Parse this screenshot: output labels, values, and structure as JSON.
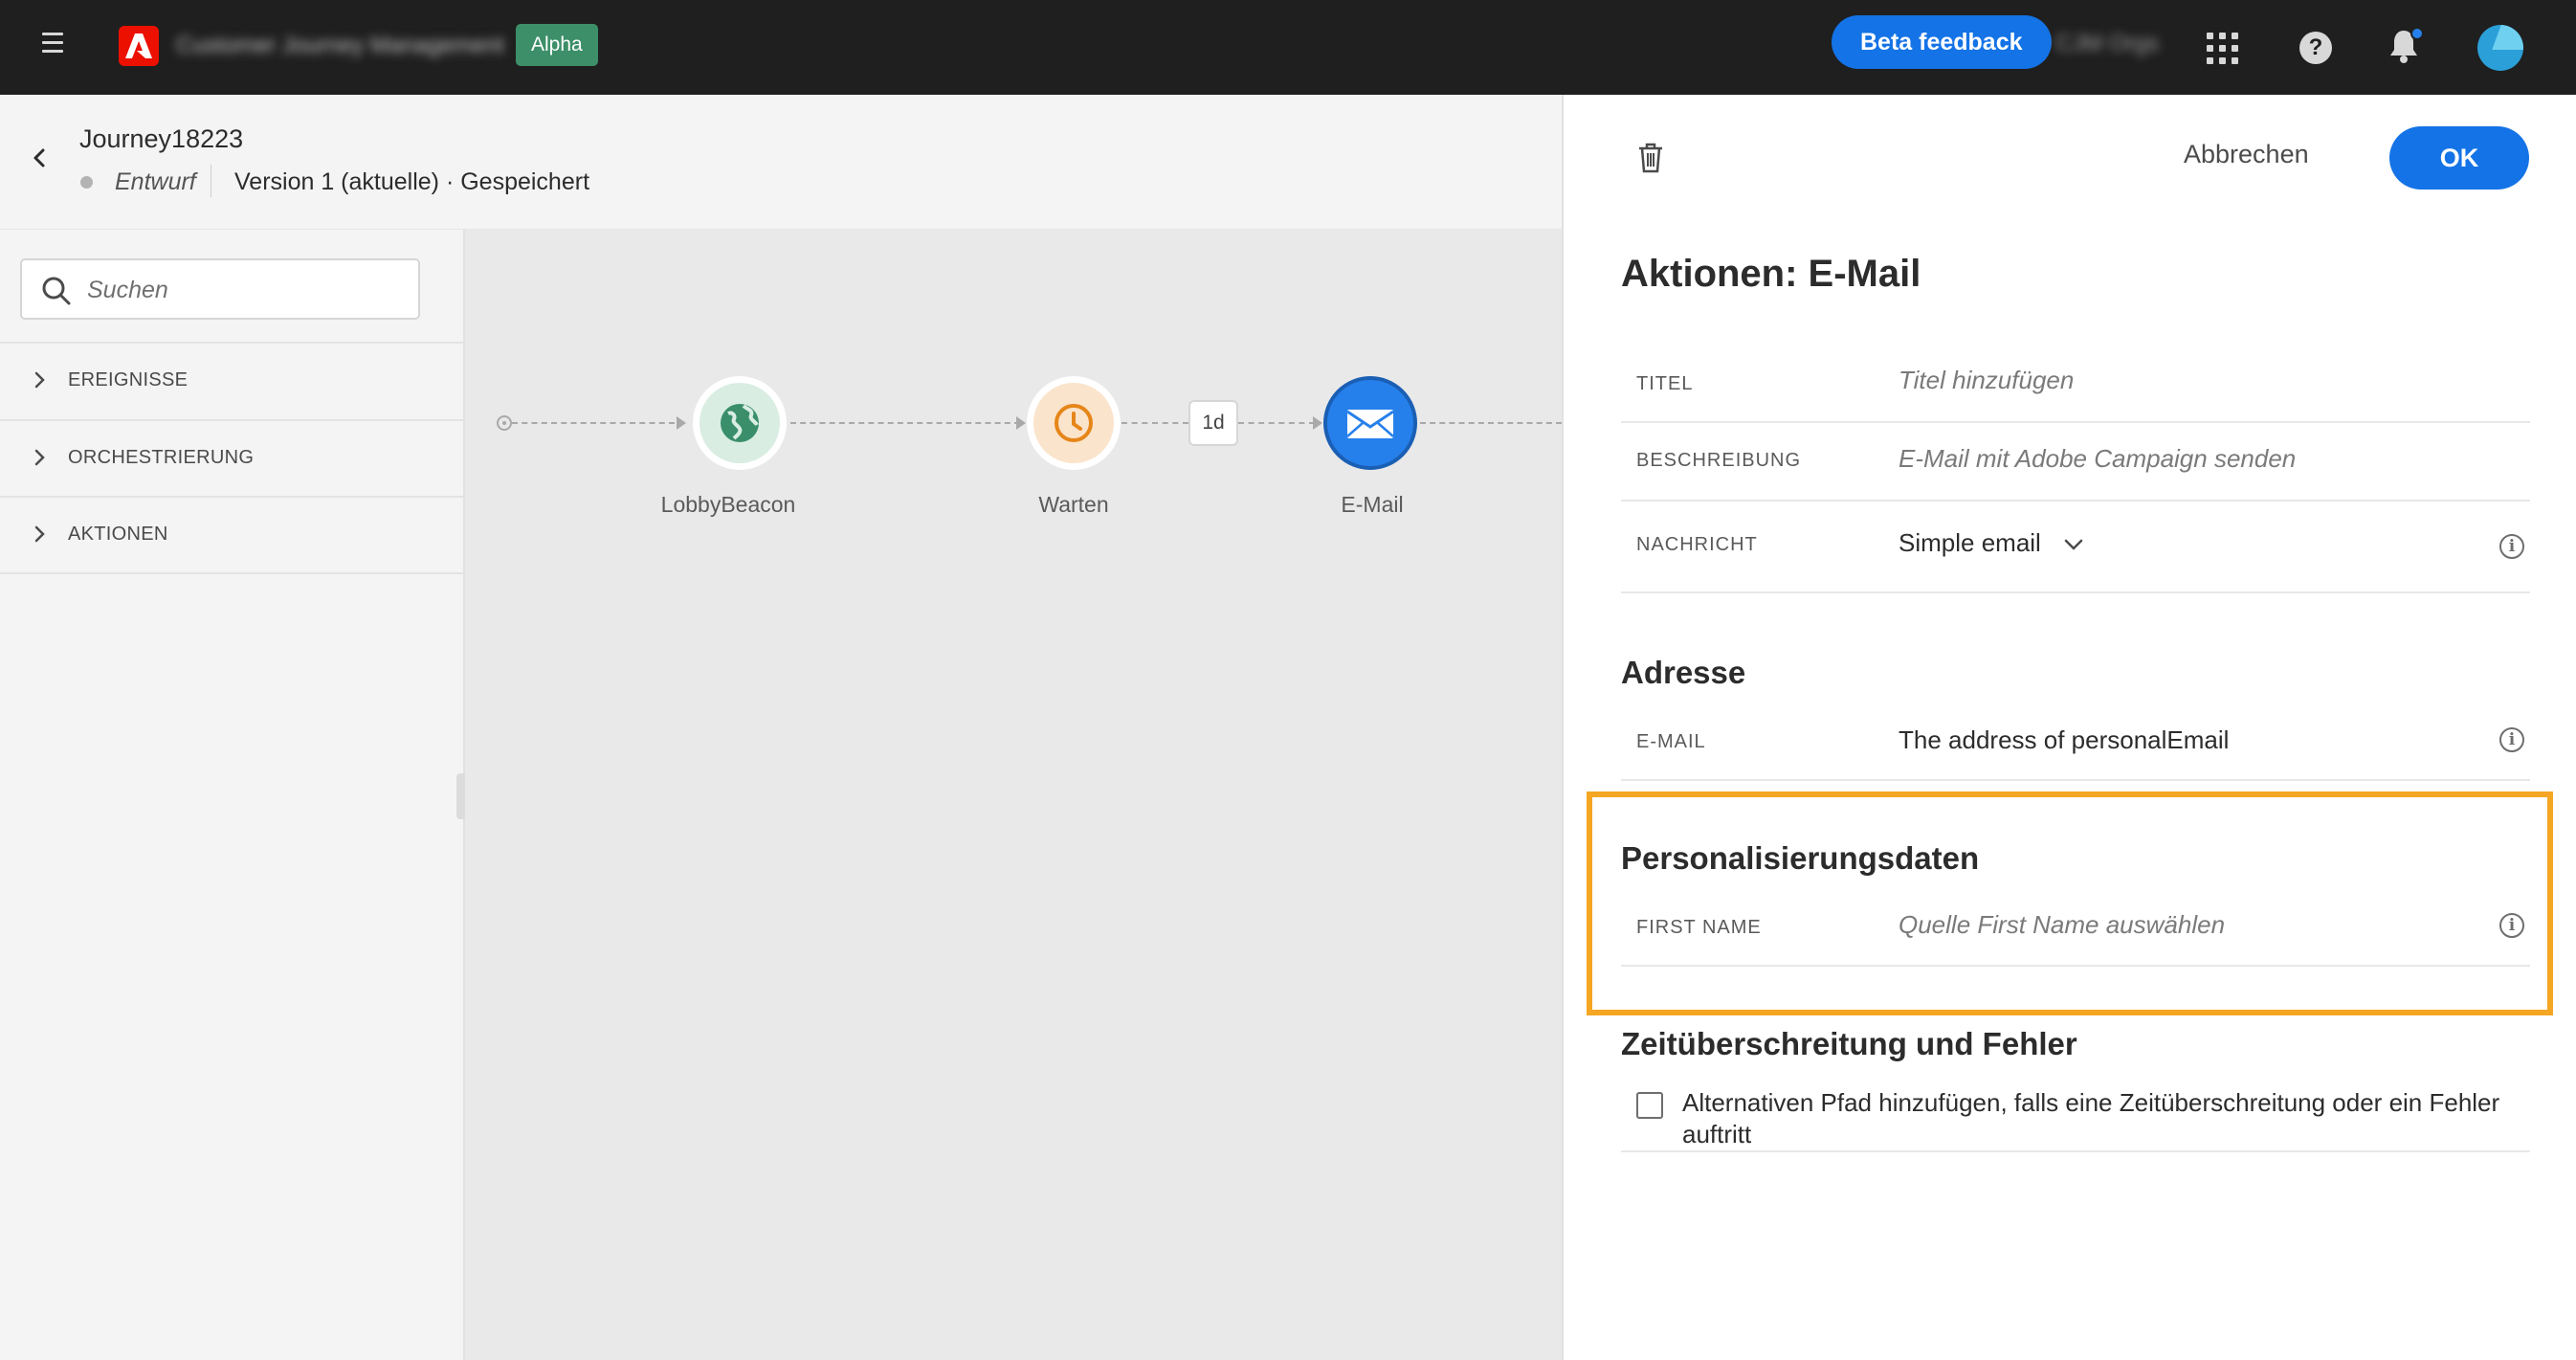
{
  "topbar": {
    "app_name": "Customer Journey Management",
    "alpha_badge": "Alpha",
    "beta_feedback": "Beta feedback",
    "org_name": "CJM Orgs",
    "help": "?"
  },
  "journey": {
    "title": "Journey18223",
    "status": "Entwurf",
    "version": "Version 1 (aktuelle) · Gespeichert"
  },
  "palette": {
    "search_placeholder": "Suchen",
    "sections": [
      {
        "label": "EREIGNISSE"
      },
      {
        "label": "ORCHESTRIERUNG"
      },
      {
        "label": "AKTIONEN"
      }
    ]
  },
  "canvas": {
    "nodes": [
      {
        "label": "LobbyBeacon",
        "icon": "globe-icon",
        "color": "#3a8f6a"
      },
      {
        "label": "Warten",
        "icon": "clock-icon",
        "color": "#e68619"
      },
      {
        "label": "E-Mail",
        "icon": "mail-icon",
        "color": "#2680eb"
      }
    ],
    "wait_badge": "1d"
  },
  "panel": {
    "cancel": "Abbrechen",
    "ok": "OK",
    "title": "Aktionen: E-Mail",
    "fields": {
      "titel_key": "TITEL",
      "titel_placeholder": "Titel hinzufügen",
      "beschreibung_key": "BESCHREIBUNG",
      "beschreibung_placeholder": "E-Mail mit Adobe Campaign senden",
      "nachricht_key": "NACHRICHT",
      "nachricht_value": "Simple email"
    },
    "adresse": {
      "title": "Adresse",
      "email_key": "E-MAIL",
      "email_value": "The address of personalEmail"
    },
    "personalisierung": {
      "title": "Personalisierungsdaten",
      "first_name_key": "FIRST NAME",
      "first_name_placeholder": "Quelle First Name auswählen"
    },
    "timeout": {
      "title": "Zeitüberschreitung und Fehler",
      "checkbox_label": "Alternativen Pfad hinzufügen, falls eine Zeitüberschreitung oder ein Fehler auftritt"
    },
    "info_glyph": "i"
  },
  "colors": {
    "accent": "#1473e6",
    "highlight": "#f5a623",
    "topbar": "#1f1f1f"
  }
}
